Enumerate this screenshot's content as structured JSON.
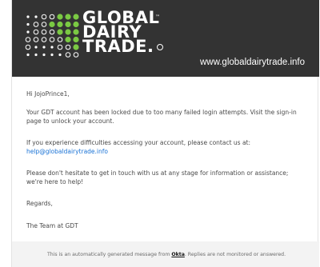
{
  "brand": {
    "line1": "GLOBAL",
    "line2": "DAIRY",
    "line3": "TRADE.",
    "trademark": "™",
    "website": "www.globaldairytrade.info"
  },
  "message": {
    "greeting": "Hi JojoPrince1,",
    "para1": "Your GDT account has been locked due to too many failed login attempts. Visit the sign-in page to unlock your account.",
    "para2": "If you experience difficulties accessing your account, please contact us at:",
    "email": "help@globaldairytrade.info",
    "para3": "Please don't hesitate to get in touch with us at any stage for information or assistance; we're here to help!",
    "regards": "Regards,",
    "signoff": "The Team at GDT"
  },
  "footer": {
    "prefix": "This is an automatically generated message from ",
    "link": "Okta",
    "suffix": ". Replies are not monitored or answered."
  },
  "colors": {
    "header_bg": "#333333",
    "dot_green": "#7ac943",
    "link": "#1a73d6"
  }
}
